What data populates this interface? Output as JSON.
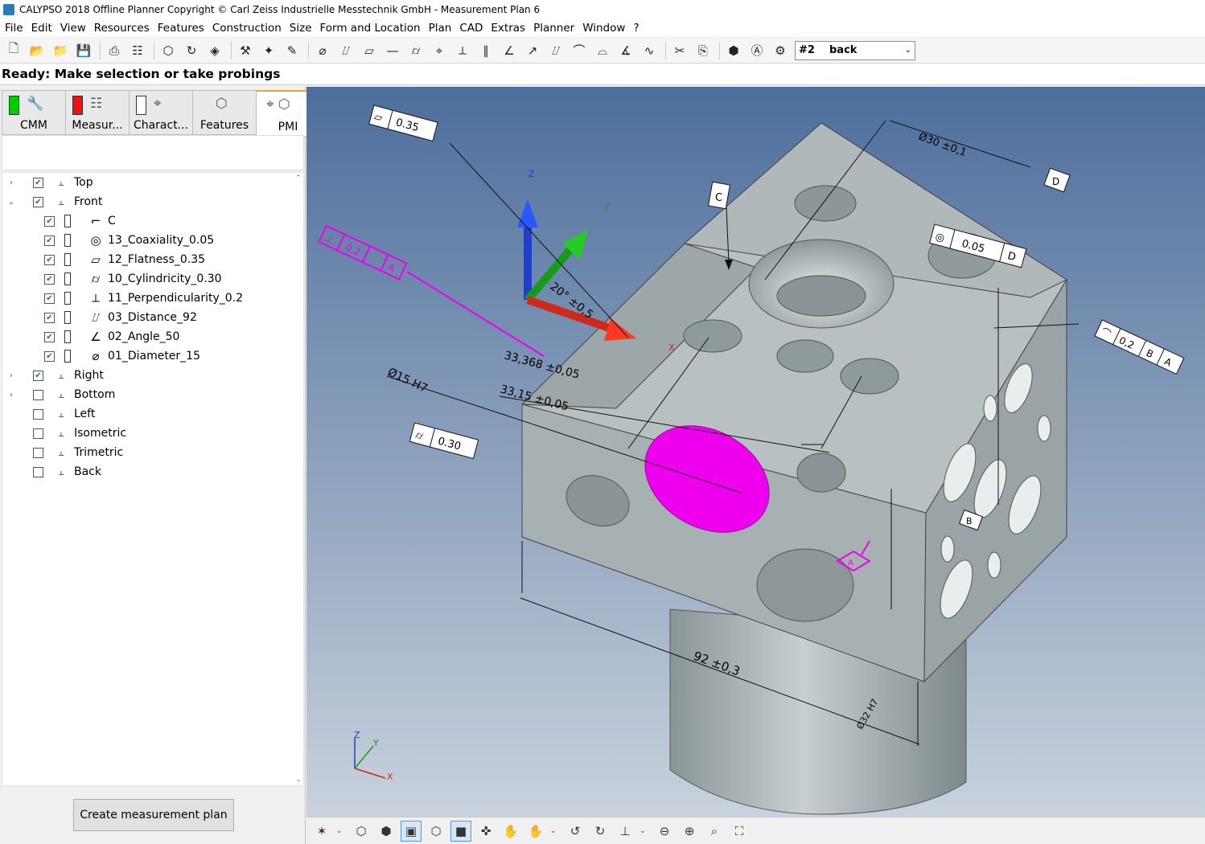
{
  "window": {
    "title": "CALYPSO 2018 Offline Planner Copyright © Carl Zeiss Industrielle Messtechnik GmbH - Measurement Plan 6"
  },
  "menu": {
    "items": [
      "File",
      "Edit",
      "View",
      "Resources",
      "Features",
      "Construction",
      "Size",
      "Form and Location",
      "Plan",
      "CAD",
      "Extras",
      "Planner",
      "Window",
      "?"
    ]
  },
  "toolbar": {
    "view_number": "#2",
    "view_name": "back"
  },
  "status": {
    "text": "Ready: Make selection or take probings"
  },
  "tabs": [
    {
      "label": "CMM",
      "color": "#00cc00"
    },
    {
      "label": "Measur...",
      "color": "#ee1111"
    },
    {
      "label": "Charact...",
      "color": "#ffffff"
    },
    {
      "label": "Features"
    },
    {
      "label": "PMI"
    }
  ],
  "tree": {
    "views": [
      {
        "label": "Top",
        "checked": true,
        "expanded": false
      },
      {
        "label": "Front",
        "checked": true,
        "expanded": true
      },
      {
        "label": "Right",
        "checked": true,
        "expanded": false
      },
      {
        "label": "Bottom",
        "checked": false,
        "expanded": false
      },
      {
        "label": "Left",
        "checked": false
      },
      {
        "label": "Isometric",
        "checked": false
      },
      {
        "label": "Trimetric",
        "checked": false
      },
      {
        "label": "Back",
        "checked": false
      }
    ],
    "front_children": [
      {
        "label": "C",
        "icon": "datum-icon"
      },
      {
        "label": "13_Coaxiality_0.05",
        "icon": "coaxiality-icon"
      },
      {
        "label": "12_Flatness_0.35",
        "icon": "flatness-icon"
      },
      {
        "label": "10_Cylindricity_0.30",
        "icon": "cylindricity-icon"
      },
      {
        "label": "11_Perpendicularity_0.2",
        "icon": "perpendicularity-icon"
      },
      {
        "label": "03_Distance_92",
        "icon": "distance-icon"
      },
      {
        "label": "02_Angle_50",
        "icon": "angle-icon"
      },
      {
        "label": "01_Diameter_15",
        "icon": "diameter-icon"
      }
    ]
  },
  "actions": {
    "create_plan": "Create measurement plan"
  },
  "viewport": {
    "background_top": "#4d6e9c",
    "background_bottom": "#c9d2dc",
    "part_color": "#a8b2b4",
    "highlight_color": "#ee00ee",
    "triad_labels": [
      "Z",
      "Y",
      "X"
    ],
    "annotations": {
      "flatness_value": "0.35",
      "cylindricity_value": "0.30",
      "coaxiality_value": "0.05",
      "coaxiality_datum": "D",
      "datum_c": "C",
      "dim_33_368": "33,368 ±0,05",
      "dim_33_15": "33,15 ±0,05",
      "dim_15": "Ø15 H7",
      "dim_30": "Ø30 ±0,1",
      "datum_d": "D",
      "dim_20": "20° ±0,5",
      "dim_92": "92 ±0,3",
      "profile_tol": "0,2",
      "profile_datum_b": "B",
      "profile_datum_a": "A",
      "datum_b": "B",
      "datum_a": "A",
      "pink_value": "0,2",
      "pink_datum": "A",
      "dim_32": "Ø32 H7"
    }
  }
}
